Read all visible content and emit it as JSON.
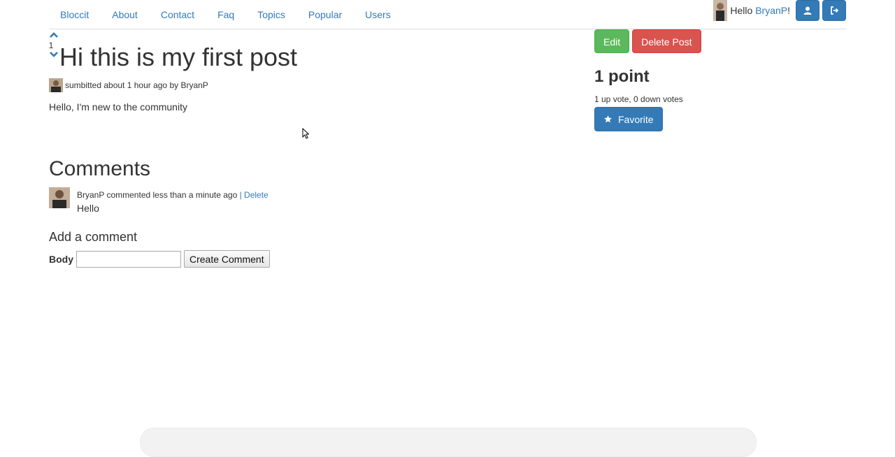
{
  "nav": {
    "links": [
      "Bloccit",
      "About",
      "Contact",
      "Faq",
      "Topics",
      "Popular",
      "Users"
    ],
    "greeting_prefix": "Hello ",
    "username": "BryanP",
    "greeting_suffix": "!",
    "icons": {
      "profile": "user-icon",
      "logout": "sign-out-icon"
    }
  },
  "post": {
    "vote_count": "1",
    "title": "Hi this is my first post",
    "submitted": "sumbitted about 1 hour ago by BryanP",
    "body": "Hello, I'm new to the community"
  },
  "sidebar": {
    "edit_label": "Edit",
    "delete_label": "Delete Post",
    "points": "1 point",
    "votes_summary": "1 up vote, 0 down votes",
    "favorite_label": "Favorite"
  },
  "comments": {
    "heading": "Comments",
    "items": [
      {
        "meta": "BryanP commented less than a minute ago",
        "separator": " | ",
        "delete_label": "Delete",
        "body": "Hello"
      }
    ]
  },
  "add_comment": {
    "heading": "Add a comment",
    "body_label": "Body",
    "body_value": "",
    "submit_label": "Create Comment"
  },
  "colors": {
    "link": "#337ab7",
    "primary": "#337ab7",
    "success": "#5cb85c",
    "danger": "#d9534f",
    "text": "#333333"
  }
}
